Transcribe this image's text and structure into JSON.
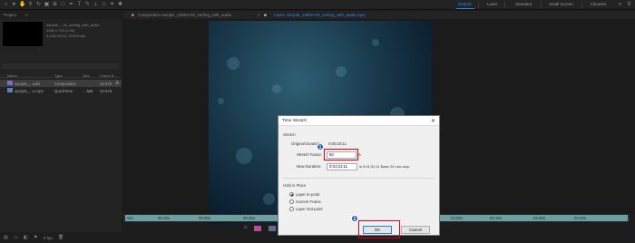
{
  "workspaces": [
    "Default",
    "Learn",
    "Standard",
    "Small Screen",
    "Libraries"
  ],
  "project": {
    "tab_label": "Project",
    "comp_name": "sample_...20_surfing_with_audio",
    "comp_size": "1280 x 720 (1.00)",
    "comp_info": "Δ 0;00;33;11, 23.976 fps",
    "columns": {
      "name": "Name",
      "type": "Type",
      "size": "Size",
      "frame": "Frame R..."
    },
    "items": [
      {
        "name": "sample_...udio",
        "type": "Composition",
        "size": "",
        "frame": "23.976"
      },
      {
        "name": "sample_...o.mp4",
        "type": "QuickTime",
        "size": "... MB",
        "frame": "23.976"
      }
    ],
    "footer_bpc": "8 bpc"
  },
  "composition_tab": "Composition sample_1280x720_surfing_with_audio",
  "layer_tab": "Layer: sample_1280x720_surfing_with_audio.mp4",
  "timeline_ticks": [
    "00s",
    "00;15s",
    "00;30s",
    "00;45s",
    "01;00s",
    "01;15s",
    "01;30s",
    "01;45s",
    "02;00s",
    "02;15s",
    "02;30s",
    "02;45s"
  ],
  "dialog": {
    "title": "Time Stretch",
    "stretch_group": "Stretch",
    "original_duration_label": "Original Duration:",
    "original_duration_value": "0;00;33;11",
    "stretch_factor_label": "Stretch Factor:",
    "stretch_factor_value": "50",
    "stretch_factor_unit": "%",
    "new_duration_label": "New Duration:",
    "new_duration_value": "0;01;31;11",
    "new_duration_note": "is 0;01;31;11  Base 24  non-drop",
    "hold_group": "Hold in Place",
    "options": [
      "Layer In-point",
      "Current Frame",
      "Layer Out-point"
    ],
    "selected_option": 0,
    "ok_label": "OK",
    "cancel_label": "Cancel"
  },
  "annotations": [
    "1",
    "2"
  ],
  "colors": {
    "accent": "#2d8ceb",
    "highlight": "#d9001b",
    "badge": "#1e5bb8"
  }
}
